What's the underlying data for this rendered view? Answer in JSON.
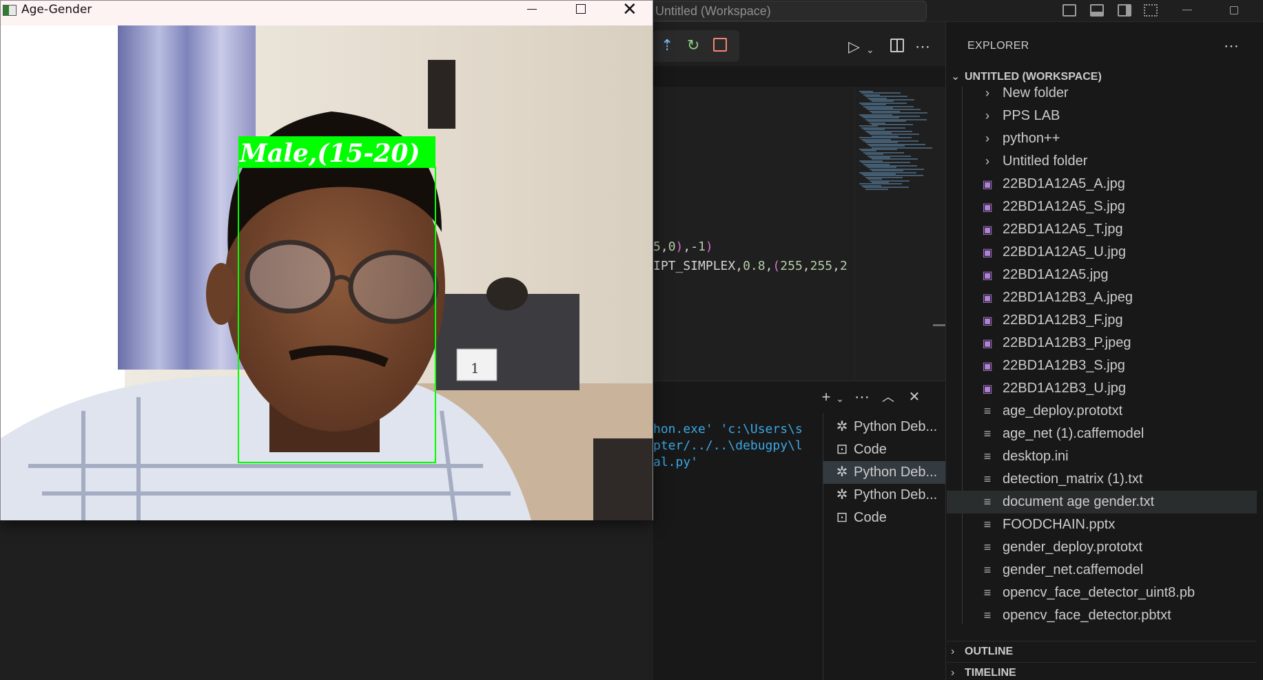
{
  "vscode": {
    "command_center_text": "Untitled (Workspace)",
    "code_lines": [
      {
        "parts": [
          {
            "t": "5",
            "c": "c-num"
          },
          {
            "t": ",",
            "c": "c-punc"
          },
          {
            "t": "0",
            "c": "c-num"
          },
          {
            "t": ")",
            "c": "c-paren"
          },
          {
            "t": ",-",
            "c": "c-punc"
          },
          {
            "t": "1",
            "c": "c-num"
          },
          {
            "t": ")",
            "c": "c-paren"
          }
        ]
      },
      {
        "parts": [
          {
            "t": "IPT_SIMPLEX",
            "c": "c-ident"
          },
          {
            "t": ",",
            "c": "c-punc"
          },
          {
            "t": "0.8",
            "c": "c-num"
          },
          {
            "t": ",",
            "c": "c-punc"
          },
          {
            "t": "(",
            "c": "c-paren"
          },
          {
            "t": "255",
            "c": "c-num"
          },
          {
            "t": ",",
            "c": "c-punc"
          },
          {
            "t": "255",
            "c": "c-num"
          },
          {
            "t": ",",
            "c": "c-punc"
          },
          {
            "t": "2",
            "c": "c-num"
          }
        ]
      }
    ],
    "terminal_lines": [
      "hon.exe' 'c:\\Users\\s",
      "pter/../..\\debugpy\\l",
      "al.py'"
    ],
    "terminal_list": [
      {
        "label": "Python Deb...",
        "icon": "debug",
        "selected": false
      },
      {
        "label": "Code",
        "icon": "terminal",
        "selected": false
      },
      {
        "label": "Python Deb...",
        "icon": "debug",
        "selected": true
      },
      {
        "label": "Python Deb...",
        "icon": "debug",
        "selected": false
      },
      {
        "label": "Code",
        "icon": "terminal",
        "selected": false
      }
    ],
    "explorer": {
      "title": "EXPLORER",
      "workspace_header": "UNTITLED (WORKSPACE)",
      "items": [
        {
          "label": "New folder",
          "kind": "folder"
        },
        {
          "label": "PPS LAB",
          "kind": "folder"
        },
        {
          "label": "python++",
          "kind": "folder"
        },
        {
          "label": "Untitled folder",
          "kind": "folder"
        },
        {
          "label": "22BD1A12A5_A.jpg",
          "kind": "image"
        },
        {
          "label": "22BD1A12A5_S.jpg",
          "kind": "image"
        },
        {
          "label": "22BD1A12A5_T.jpg",
          "kind": "image"
        },
        {
          "label": "22BD1A12A5_U.jpg",
          "kind": "image"
        },
        {
          "label": "22BD1A12A5.jpg",
          "kind": "image"
        },
        {
          "label": "22BD1A12B3_A.jpeg",
          "kind": "image"
        },
        {
          "label": "22BD1A12B3_F.jpg",
          "kind": "image"
        },
        {
          "label": "22BD1A12B3_P.jpeg",
          "kind": "image"
        },
        {
          "label": "22BD1A12B3_S.jpg",
          "kind": "image"
        },
        {
          "label": "22BD1A12B3_U.jpg",
          "kind": "image"
        },
        {
          "label": "age_deploy.prototxt",
          "kind": "text"
        },
        {
          "label": "age_net (1).caffemodel",
          "kind": "text"
        },
        {
          "label": "desktop.ini",
          "kind": "text"
        },
        {
          "label": "detection_matrix (1).txt",
          "kind": "text"
        },
        {
          "label": "document age gender.txt",
          "kind": "text",
          "selected": true
        },
        {
          "label": "FOODCHAIN.pptx",
          "kind": "text"
        },
        {
          "label": "gender_deploy.prototxt",
          "kind": "text"
        },
        {
          "label": "gender_net.caffemodel",
          "kind": "text"
        },
        {
          "label": "opencv_face_detector_uint8.pb",
          "kind": "text"
        },
        {
          "label": "opencv_face_detector.pbtxt",
          "kind": "text"
        }
      ],
      "outline_label": "OUTLINE",
      "timeline_label": "TIMELINE"
    }
  },
  "cv_window": {
    "title": "Age-Gender",
    "detection_label": "Male,(15-20)",
    "box_color": "#00ff00",
    "desk_sign_text": "1"
  }
}
